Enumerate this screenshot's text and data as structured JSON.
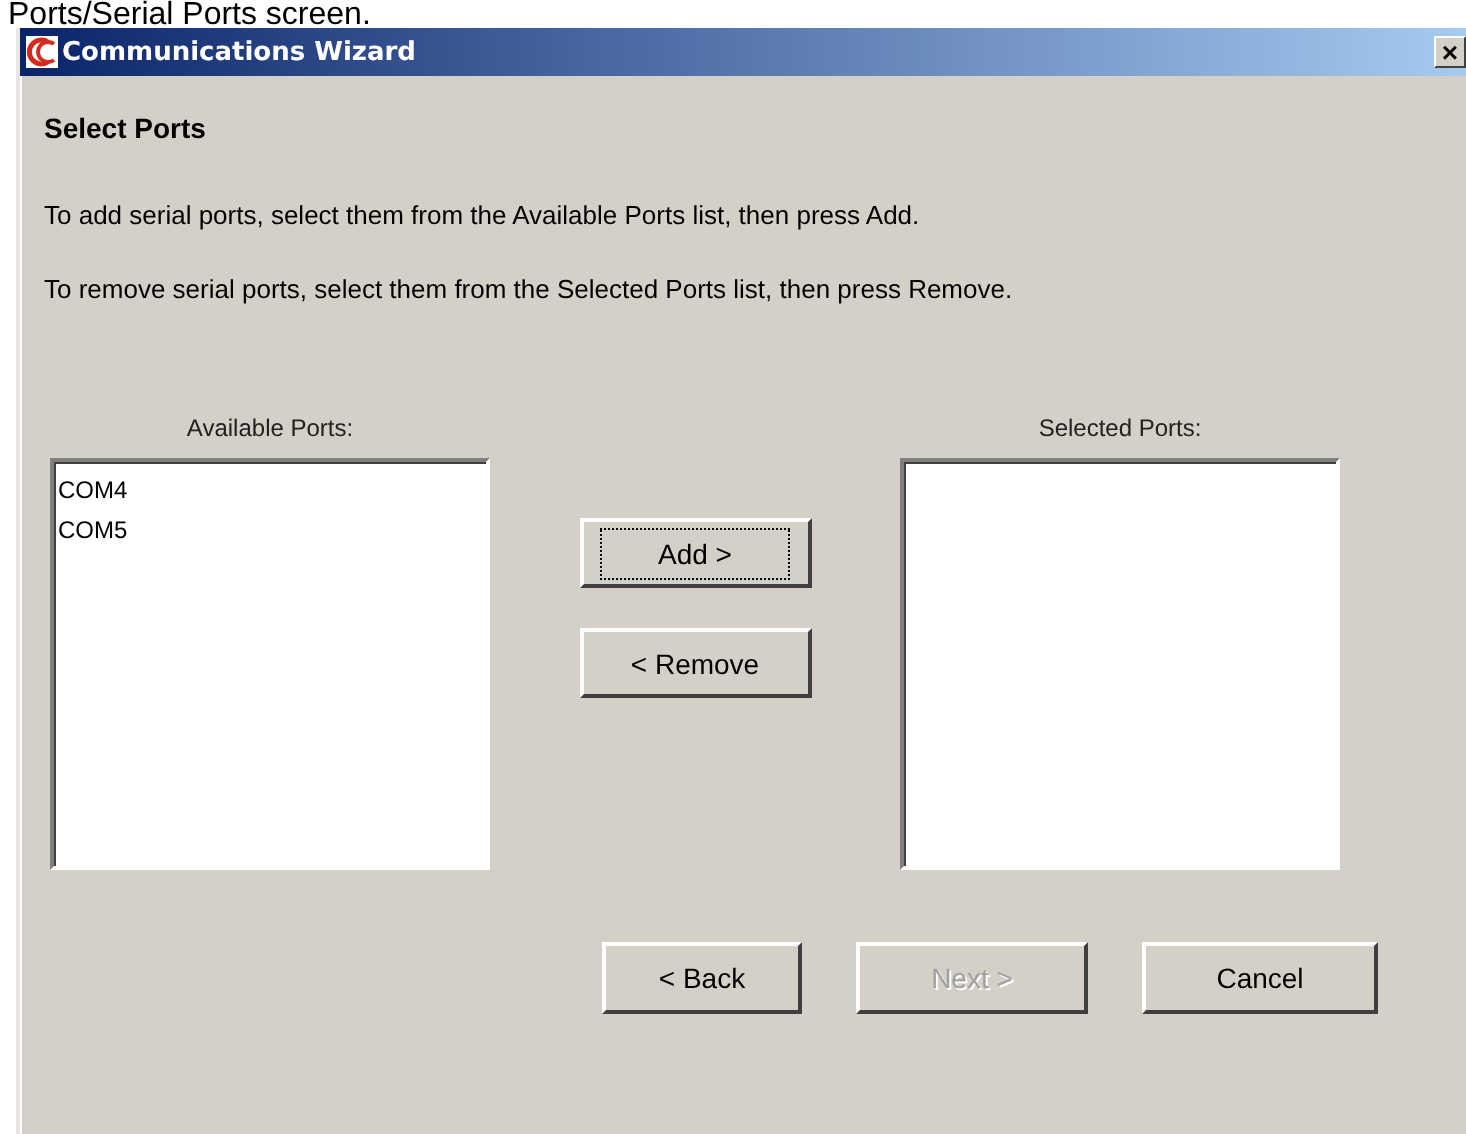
{
  "caption": "Ports/Serial Ports screen.",
  "window": {
    "title": "Communications Wizard",
    "close": "×"
  },
  "heading": "Select Ports",
  "instructions": [
    "To add serial ports, select them from the Available Ports list, then press Add.",
    "To remove serial ports, select them from the Selected Ports list, then press Remove."
  ],
  "available": {
    "label": "Available Ports:",
    "items": [
      {
        "text": "COM4",
        "selected": false
      },
      {
        "text": "COM5",
        "selected": false
      }
    ]
  },
  "move_buttons": [
    {
      "label": "Add >",
      "focused": true
    },
    {
      "label": "< Remove",
      "focused": false
    }
  ],
  "selected": {
    "label": "Selected Ports:"
  },
  "buttons": [
    {
      "label": "< Back",
      "disabled": false
    },
    {
      "label": "Next >",
      "disabled": true
    },
    {
      "label": "Cancel",
      "disabled": false
    }
  ]
}
